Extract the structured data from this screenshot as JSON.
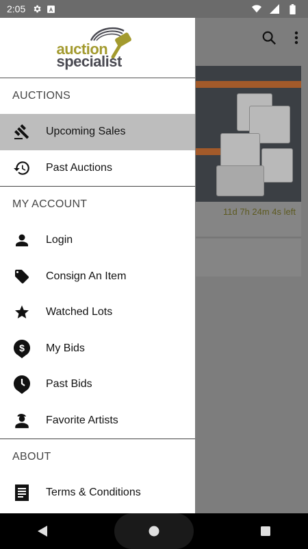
{
  "status_bar": {
    "time": "2:05"
  },
  "background_app": {
    "time_left": "11d 7h 24m 4s left"
  },
  "drawer": {
    "sections": [
      {
        "title": "AUCTIONS",
        "items": [
          {
            "label": "Upcoming Sales",
            "icon": "gavel-icon"
          },
          {
            "label": "Past Auctions",
            "icon": "history-icon"
          }
        ]
      },
      {
        "title": "MY ACCOUNT",
        "items": [
          {
            "label": "Login",
            "icon": "person-icon"
          },
          {
            "label": "Consign An Item",
            "icon": "tag-icon"
          },
          {
            "label": "Watched Lots",
            "icon": "star-icon"
          },
          {
            "label": "My Bids",
            "icon": "dollar-pin-icon"
          },
          {
            "label": "Past Bids",
            "icon": "clock-pin-icon"
          },
          {
            "label": "Favorite Artists",
            "icon": "artist-icon"
          }
        ]
      },
      {
        "title": "ABOUT",
        "items": [
          {
            "label": "Terms & Conditions",
            "icon": "document-icon"
          }
        ]
      }
    ]
  },
  "logo": {
    "line1": "auction",
    "line2": "specialist"
  },
  "colors": {
    "accent_gold": "#a39a2e",
    "logo_gray": "#4a4a52",
    "active_item_bg": "#bdbdbd"
  }
}
